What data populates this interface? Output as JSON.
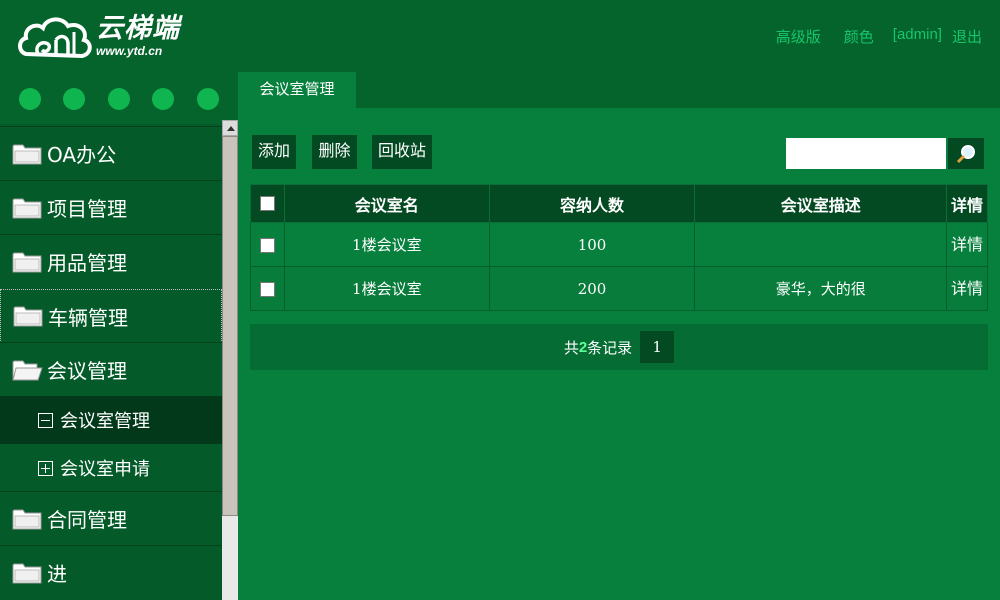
{
  "header": {
    "logo_name": "云梯端",
    "logo_url": "www.ytd.cn",
    "links": [
      "高级版",
      "颜色",
      "[admin]",
      "退出"
    ]
  },
  "tabs": [
    {
      "label": "会议室管理"
    }
  ],
  "sidebar": {
    "items": [
      {
        "label": "OA办公"
      },
      {
        "label": "项目管理"
      },
      {
        "label": "用品管理"
      },
      {
        "label": "车辆管理"
      },
      {
        "label": "会议管理"
      },
      {
        "label": "合同管理"
      },
      {
        "label": "进"
      }
    ],
    "sub_items": [
      {
        "label": "会议室管理"
      },
      {
        "label": "会议室申请"
      }
    ]
  },
  "toolbar": {
    "add": "添加",
    "delete": "删除",
    "recycle": "回收站",
    "search_value": ""
  },
  "table": {
    "columns": [
      "会议室名",
      "容纳人数",
      "会议室描述",
      "详情"
    ],
    "rows": [
      {
        "name": "1楼会议室",
        "capacity": "100",
        "description": "",
        "detail": "详情"
      },
      {
        "name": "1楼会议室",
        "capacity": "200",
        "description": "豪华，大的很",
        "detail": "详情"
      }
    ]
  },
  "pager": {
    "prefix": "共",
    "count": "2",
    "suffix": "条记录",
    "page": "1"
  },
  "colors": {
    "header_bg": "#04642c",
    "content_bg": "#07803d",
    "dark_button": "#034a22",
    "accent_dot": "#0fb54f"
  }
}
